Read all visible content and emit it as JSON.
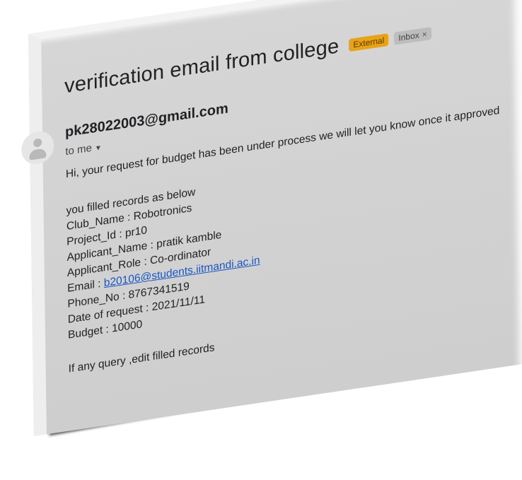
{
  "email": {
    "subject": "verification email from college",
    "labels": {
      "external": "External",
      "inbox": "Inbox",
      "inbox_close": "×"
    },
    "sender": "pk28022003@gmail.com",
    "recipient_line": "to me",
    "recipient_caret": "▼",
    "intro": "Hi, your request for budget has been under process we will let you know once it approved",
    "records_heading": "you filled records as below",
    "records": {
      "club_name": "Club_Name : Robotronics",
      "project_id": "Project_Id : pr10",
      "applicant_name": "Applicant_Name : pratik kamble",
      "applicant_role": "Applicant_Role : Co-ordinator",
      "email_label": "Email : ",
      "email_value": "b20106@students.iitmandi.ac.in",
      "phone": "Phone_No : 8767341519",
      "date": "Date of request : 2021/11/11",
      "budget": "Budget : 10000"
    },
    "footer": "If any query ,edit filled records"
  },
  "colors": {
    "external_badge": "#e8a317",
    "inbox_badge": "#bdbdbd",
    "link": "#1a56c4",
    "card_background": "#d2d2d2"
  },
  "icons": {
    "avatar": "person-avatar-icon"
  }
}
